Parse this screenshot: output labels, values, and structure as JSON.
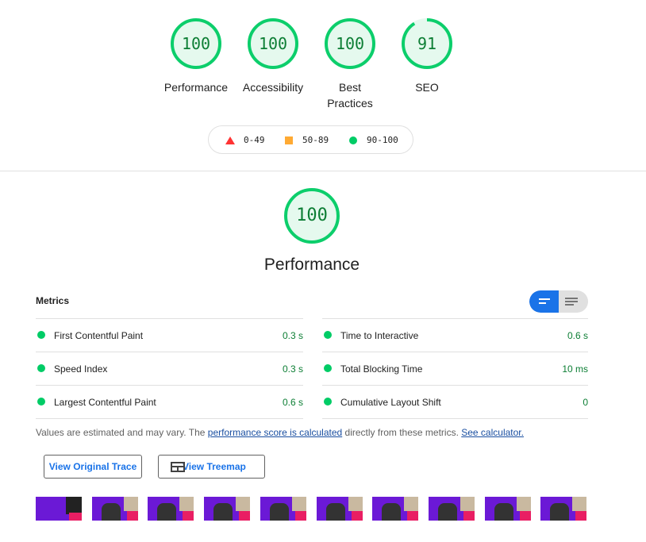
{
  "gauges": [
    {
      "score": "100",
      "label": "Performance"
    },
    {
      "score": "100",
      "label": "Accessibility"
    },
    {
      "score": "100",
      "label": "Best Practices"
    },
    {
      "score": "91",
      "label": "SEO"
    }
  ],
  "legend": {
    "fail": "0-49",
    "average": "50-89",
    "pass": "90-100"
  },
  "category": {
    "score": "100",
    "title": "Performance"
  },
  "metrics_header": "Metrics",
  "metrics": {
    "fcp": {
      "name": "First Contentful Paint",
      "value": "0.3 s"
    },
    "si": {
      "name": "Speed Index",
      "value": "0.3 s"
    },
    "lcp": {
      "name": "Largest Contentful Paint",
      "value": "0.6 s"
    },
    "tti": {
      "name": "Time to Interactive",
      "value": "0.6 s"
    },
    "tbt": {
      "name": "Total Blocking Time",
      "value": "10 ms"
    },
    "cls": {
      "name": "Cumulative Layout Shift",
      "value": "0"
    }
  },
  "note": {
    "prefix": "Values are estimated and may vary. The ",
    "link1": "performance score is calculated",
    "middle": " directly from these metrics. ",
    "link2": "See calculator."
  },
  "buttons": {
    "trace": "View Original Trace",
    "treemap": "View Treemap"
  },
  "colors": {
    "pass": "#0cce6b",
    "pass_text": "#0c7e34",
    "average": "#ffa400",
    "fail": "#ff4e42",
    "accent": "#1a73e8"
  }
}
